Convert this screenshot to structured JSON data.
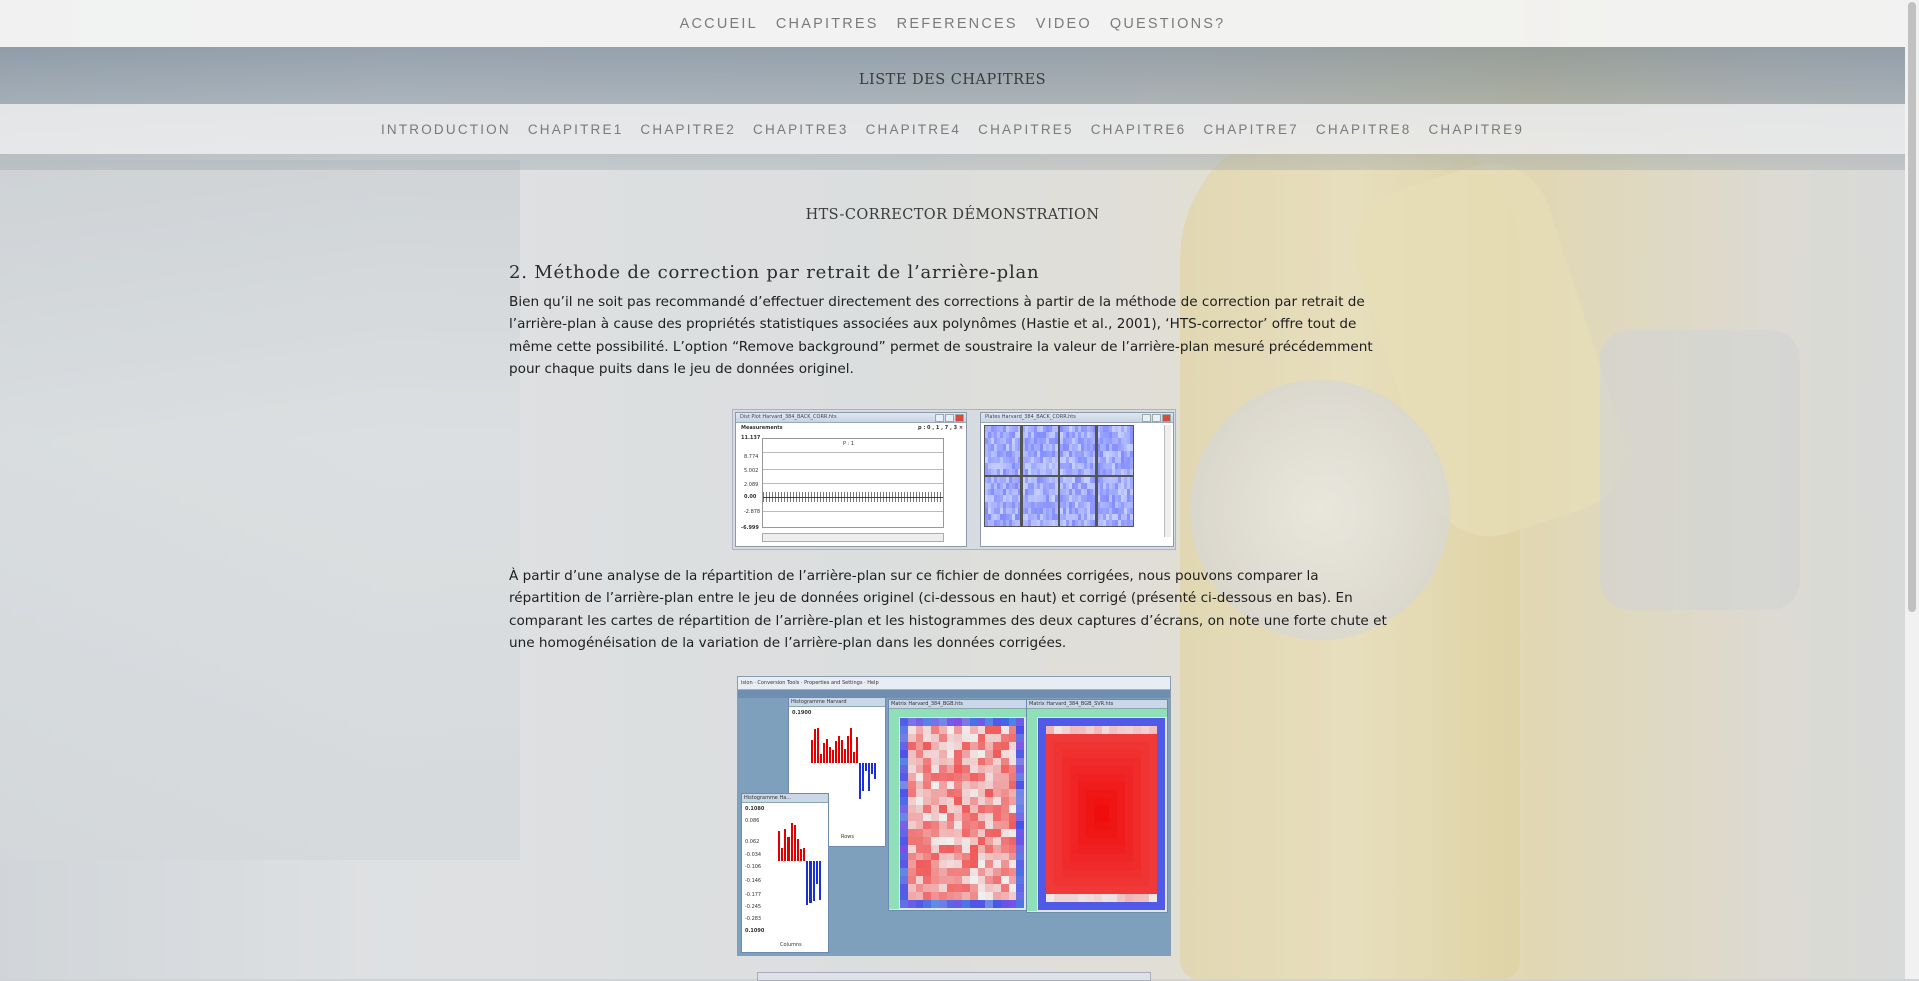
{
  "topnav": {
    "items": [
      "ACCUEIL",
      "CHAPITRES",
      "REFERENCES",
      "VIDEO",
      "QUESTIONS?"
    ]
  },
  "chapters": {
    "title": "LISTE DES CHAPITRES",
    "items": [
      "INTRODUCTION",
      "CHAPITRE1",
      "CHAPITRE2",
      "CHAPITRE3",
      "CHAPITRE4",
      "CHAPITRE5",
      "CHAPITRE6",
      "CHAPITRE7",
      "CHAPITRE8",
      "CHAPITRE9"
    ]
  },
  "page": {
    "title": "HTS-CORRECTOR DÉMONSTRATION"
  },
  "section": {
    "heading": "2. Méthode de correction par retrait de l’arrière-plan",
    "paragraph1": "Bien qu’il ne soit pas recommandé d’effectuer directement des corrections à partir de la méthode de correction par retrait de l’arrière-plan à cause des propriétés statistiques associées aux polynômes (Hastie et al., 2001), ‘HTS-corrector’ offre tout de même cette possibilité. L’option “Remove background” permet de soustraire la valeur de l’arrière-plan mesuré précédemment pour chaque puits dans le jeu de données originel.",
    "paragraph2": "À partir d’une analyse de la répartition de l’arrière-plan sur ce fichier de données corrigées, nous pouvons comparer la répartition de l’arrière-plan entre le jeu de données originel (ci-dessous en haut) et corrigé (présenté ci-dessous en bas). En comparant les cartes de répartition de l’arrière-plan et les histogrammes des deux captures d’écrans, on note une forte chute et une homogénéisation de la variation de l’arrière-plan dans les données corrigées."
  },
  "screenshot1": {
    "left_window_title": "Dist Plot Harvard_384_BACK_CORR.hts",
    "measurements_label": "Measurements",
    "top_value": "11.137",
    "bottom_value": "-6.999",
    "selector": "p : 0 , 1 , 7 , 3 ×",
    "panel_label": "P : 1",
    "ticks": [
      "8.774",
      "5.002",
      "2.089",
      "0.00",
      "-2.878"
    ],
    "right_window_title": "Plates Harvard_384_BACK_CORR.hts"
  },
  "screenshot2": {
    "menu": "ision · Conversion Tools · Properties and Settings · Help",
    "hist_top_title": "Histogramme Harvard",
    "hist_top_value": "0.1900",
    "hist_top_axis": "Rows",
    "hist_bottom_title": "Histogramme Ha...",
    "hist_bottom_value": "0.1080",
    "hist_bottom_axis": "Columns",
    "hist_bottom_last": "0.1090",
    "hist_bottom_ticks": [
      "0.086",
      "0.062",
      "-0.034",
      "-0.106",
      "-0.146",
      "-0.177",
      "-0.245",
      "-0.283"
    ],
    "heat1_title": "Matrix Harvard_384_BGB.hts",
    "heat2_title": "Matrix Harvard_384_BGB_SVR.hts"
  },
  "colors": {
    "accent_red": "#e00000",
    "accent_blue": "#1a2fd6"
  }
}
